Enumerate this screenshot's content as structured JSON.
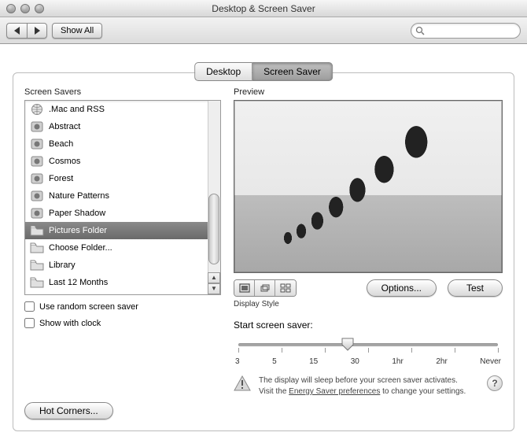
{
  "window": {
    "title": "Desktop & Screen Saver"
  },
  "toolbar": {
    "show_all_label": "Show All",
    "search_placeholder": ""
  },
  "tabs": {
    "desktop": "Desktop",
    "screen_saver": "Screen Saver"
  },
  "left": {
    "section_label": "Screen Savers",
    "items": [
      {
        "label": ".Mac and RSS",
        "icon": "globe"
      },
      {
        "label": "Abstract",
        "icon": "ss"
      },
      {
        "label": "Beach",
        "icon": "ss"
      },
      {
        "label": "Cosmos",
        "icon": "ss"
      },
      {
        "label": "Forest",
        "icon": "ss"
      },
      {
        "label": "Nature Patterns",
        "icon": "ss"
      },
      {
        "label": "Paper Shadow",
        "icon": "ss"
      },
      {
        "label": "Pictures Folder",
        "icon": "folder",
        "selected": true
      },
      {
        "label": "Choose Folder...",
        "icon": "folder"
      },
      {
        "label": "Library",
        "icon": "folder"
      },
      {
        "label": "Last 12 Months",
        "icon": "folder"
      }
    ],
    "use_random": "Use random screen saver",
    "show_clock": "Show with clock"
  },
  "right": {
    "preview_label": "Preview",
    "display_style_label": "Display Style",
    "options_label": "Options...",
    "test_label": "Test"
  },
  "slider": {
    "title": "Start screen saver:",
    "labels": [
      "3",
      "5",
      "15",
      "30",
      "1hr",
      "2hr",
      "Never"
    ]
  },
  "warning": {
    "line1": "The display will sleep before your screen saver activates.",
    "line2a": "Visit the ",
    "link": "Energy Saver preferences",
    "line2b": " to change your settings."
  },
  "hot_corners_label": "Hot Corners...",
  "help_label": "?"
}
